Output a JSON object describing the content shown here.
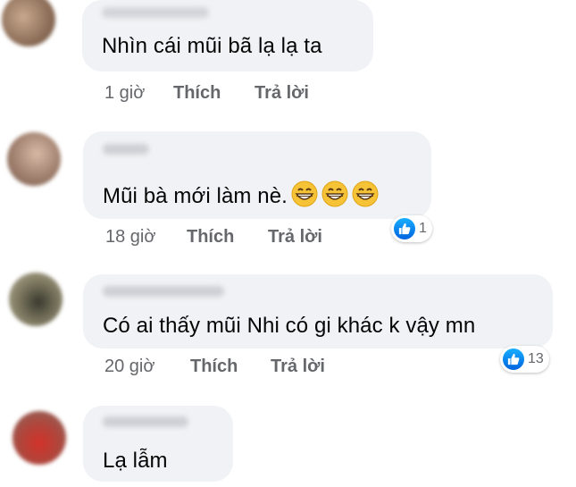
{
  "comments": [
    {
      "text": "Nhìn cái mũi bã lạ lạ ta",
      "time": "1 giờ",
      "like": "Thích",
      "reply": "Trả lời"
    },
    {
      "text": "Mũi bà mới làm nè.",
      "emoji": [
        "grinning-face",
        "grinning-face",
        "grinning-face"
      ],
      "time": "18 giờ",
      "like": "Thích",
      "reply": "Trả lời",
      "reaction_count": "1"
    },
    {
      "text": "Có ai thấy mũi Nhi có gi khác k vậy mn",
      "time": "20 giờ",
      "like": "Thích",
      "reply": "Trả lời",
      "reaction_count": "13"
    },
    {
      "text": "Lạ lẫm"
    }
  ],
  "colors": {
    "bubble": "#f0f2f5",
    "meta": "#65676b",
    "text": "#050505",
    "like_blue": "#1877f2"
  }
}
